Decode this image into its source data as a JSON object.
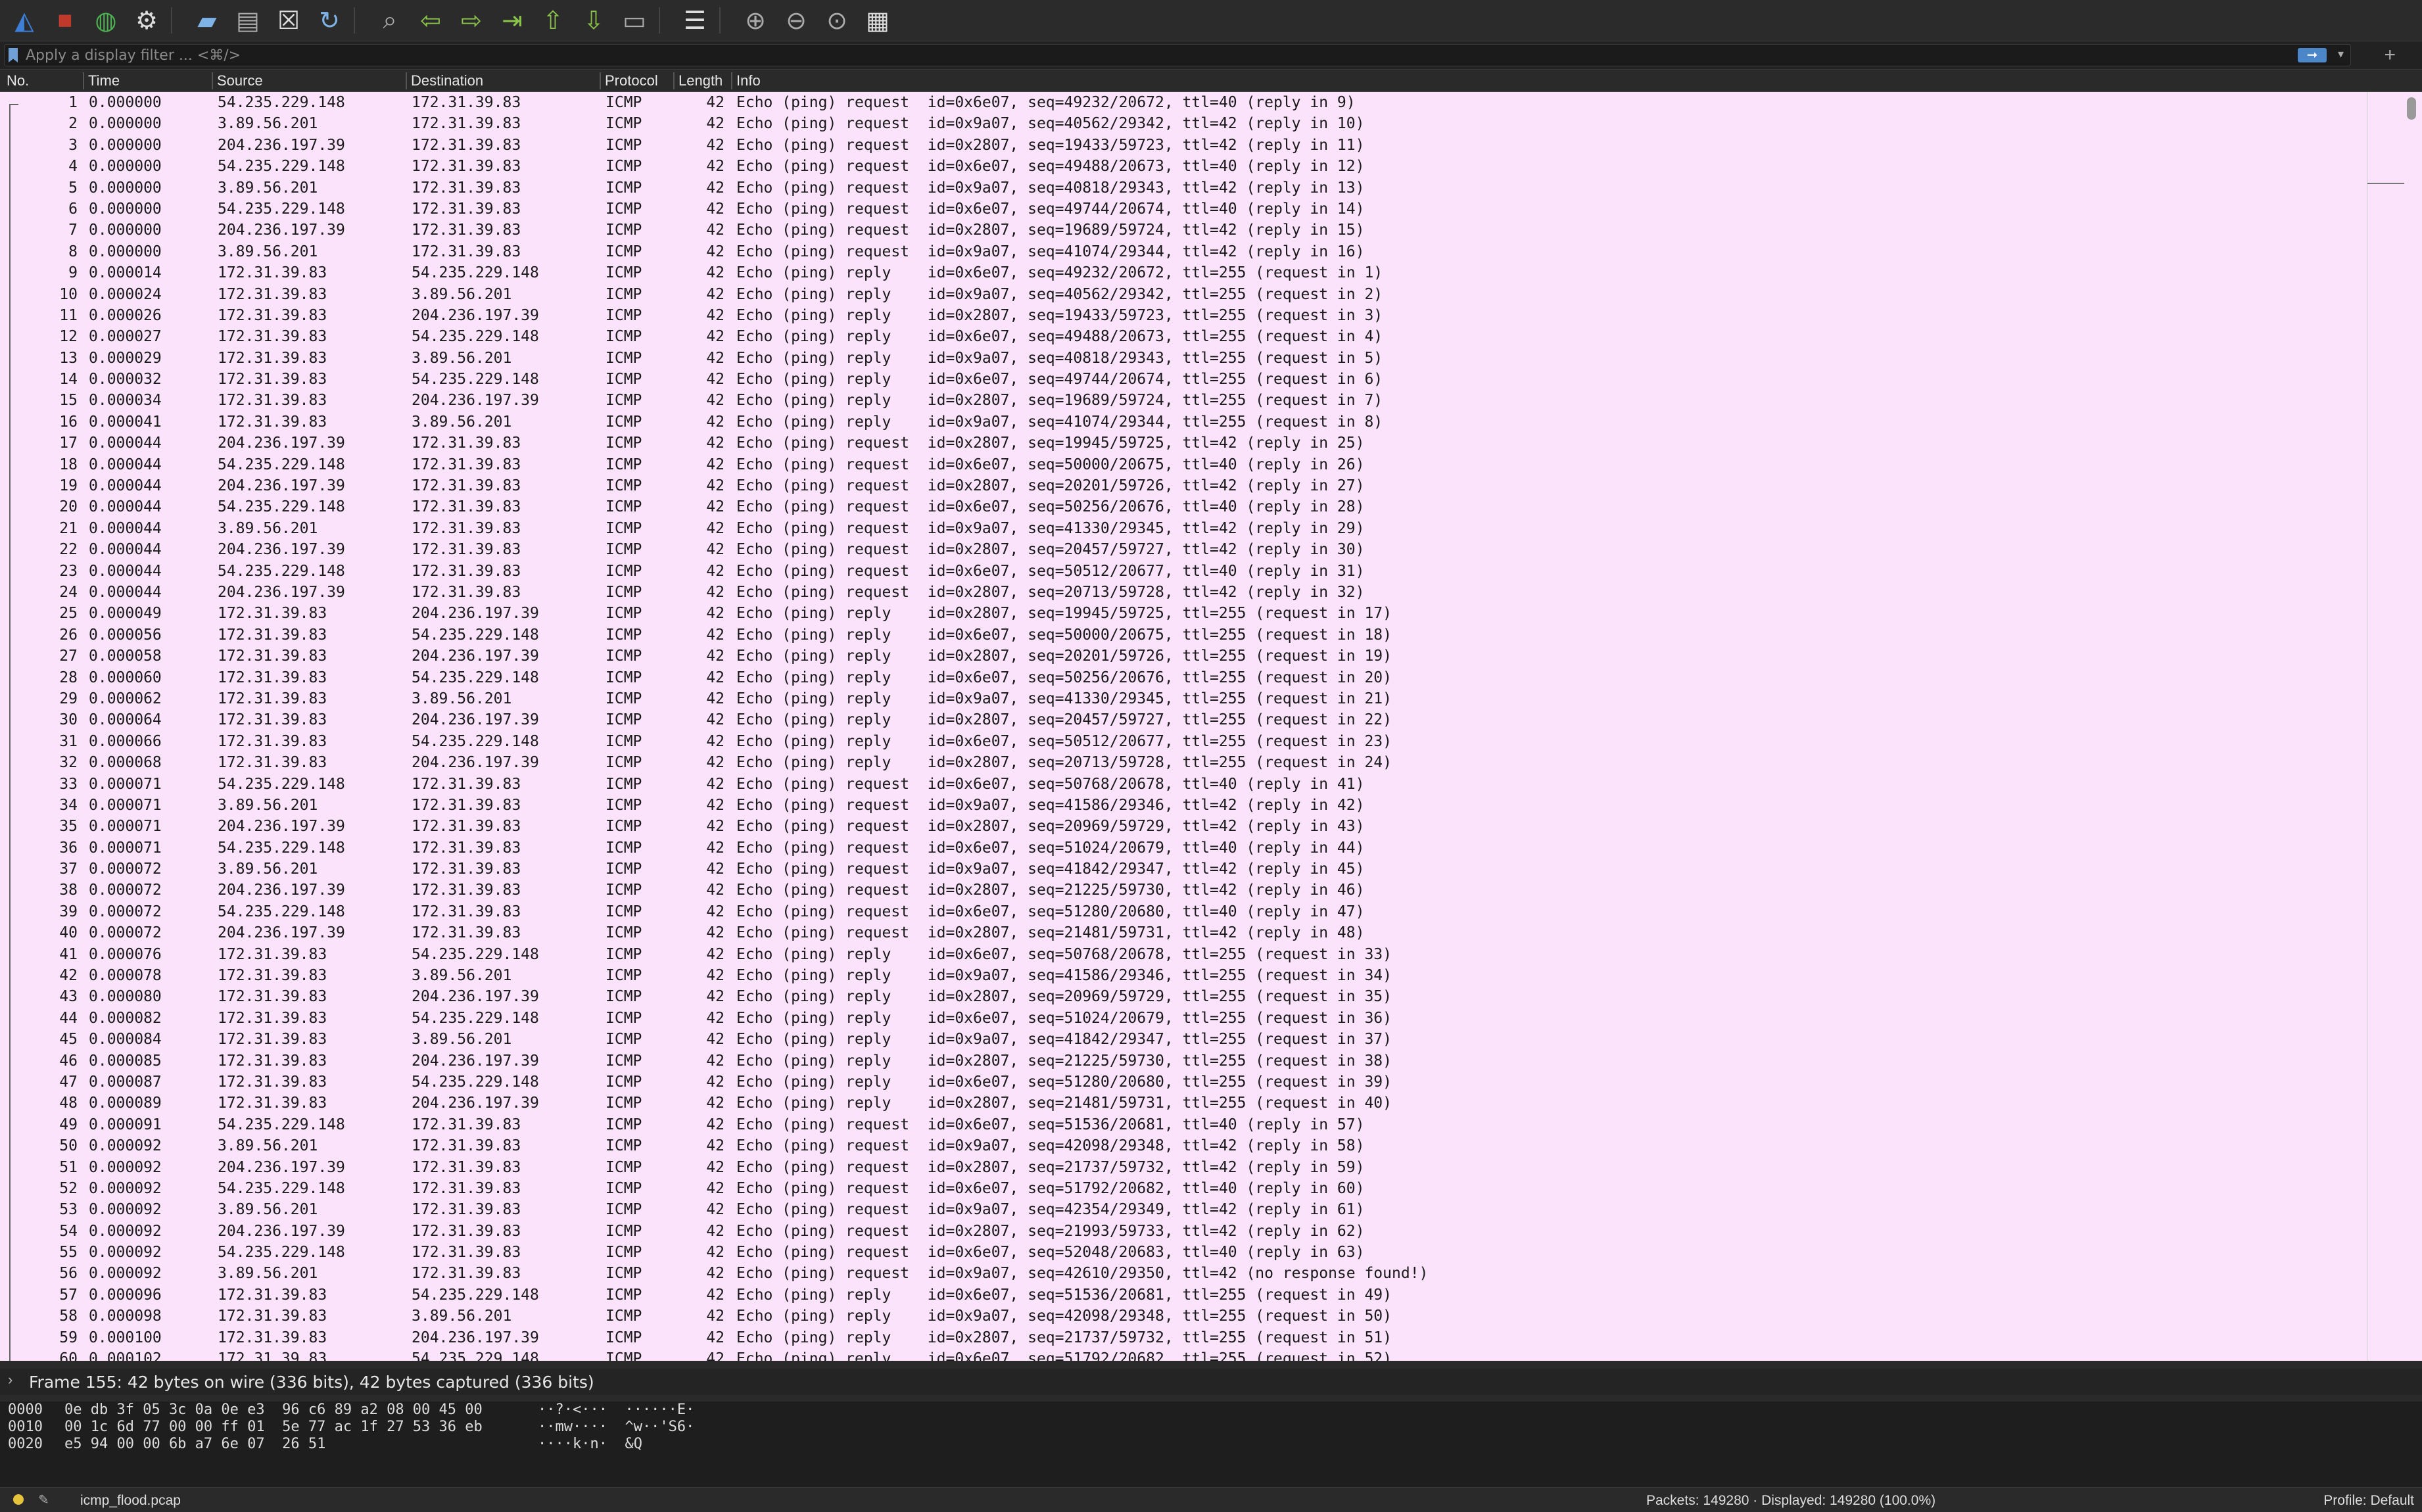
{
  "toolbar": {
    "icons": [
      "shark-fin-icon",
      "stop-icon",
      "restart-icon",
      "gear-icon",
      "open-folder-icon",
      "file-icon",
      "close-file-icon",
      "reload-icon",
      "search-icon",
      "back-arrow-icon",
      "forward-arrow-icon",
      "go-to-packet-icon",
      "first-packet-icon",
      "last-packet-icon",
      "autoscroll-icon",
      "colorize-icon",
      "zoom-in-icon",
      "zoom-out-icon",
      "zoom-normal-icon",
      "resize-columns-icon"
    ]
  },
  "filter": {
    "placeholder": "Apply a display filter ... <⌘/>"
  },
  "columns": {
    "no": "No.",
    "time": "Time",
    "source": "Source",
    "destination": "Destination",
    "protocol": "Protocol",
    "length": "Length",
    "info": "Info"
  },
  "packets": [
    {
      "no": "1",
      "time": "0.000000",
      "src": "54.235.229.148",
      "dst": "172.31.39.83",
      "proto": "ICMP",
      "len": "42",
      "info": "Echo (ping) request  id=0x6e07, seq=49232/20672, ttl=40 (reply in 9)"
    },
    {
      "no": "2",
      "time": "0.000000",
      "src": "3.89.56.201",
      "dst": "172.31.39.83",
      "proto": "ICMP",
      "len": "42",
      "info": "Echo (ping) request  id=0x9a07, seq=40562/29342, ttl=42 (reply in 10)"
    },
    {
      "no": "3",
      "time": "0.000000",
      "src": "204.236.197.39",
      "dst": "172.31.39.83",
      "proto": "ICMP",
      "len": "42",
      "info": "Echo (ping) request  id=0x2807, seq=19433/59723, ttl=42 (reply in 11)"
    },
    {
      "no": "4",
      "time": "0.000000",
      "src": "54.235.229.148",
      "dst": "172.31.39.83",
      "proto": "ICMP",
      "len": "42",
      "info": "Echo (ping) request  id=0x6e07, seq=49488/20673, ttl=40 (reply in 12)"
    },
    {
      "no": "5",
      "time": "0.000000",
      "src": "3.89.56.201",
      "dst": "172.31.39.83",
      "proto": "ICMP",
      "len": "42",
      "info": "Echo (ping) request  id=0x9a07, seq=40818/29343, ttl=42 (reply in 13)"
    },
    {
      "no": "6",
      "time": "0.000000",
      "src": "54.235.229.148",
      "dst": "172.31.39.83",
      "proto": "ICMP",
      "len": "42",
      "info": "Echo (ping) request  id=0x6e07, seq=49744/20674, ttl=40 (reply in 14)"
    },
    {
      "no": "7",
      "time": "0.000000",
      "src": "204.236.197.39",
      "dst": "172.31.39.83",
      "proto": "ICMP",
      "len": "42",
      "info": "Echo (ping) request  id=0x2807, seq=19689/59724, ttl=42 (reply in 15)"
    },
    {
      "no": "8",
      "time": "0.000000",
      "src": "3.89.56.201",
      "dst": "172.31.39.83",
      "proto": "ICMP",
      "len": "42",
      "info": "Echo (ping) request  id=0x9a07, seq=41074/29344, ttl=42 (reply in 16)"
    },
    {
      "no": "9",
      "time": "0.000014",
      "src": "172.31.39.83",
      "dst": "54.235.229.148",
      "proto": "ICMP",
      "len": "42",
      "info": "Echo (ping) reply    id=0x6e07, seq=49232/20672, ttl=255 (request in 1)"
    },
    {
      "no": "10",
      "time": "0.000024",
      "src": "172.31.39.83",
      "dst": "3.89.56.201",
      "proto": "ICMP",
      "len": "42",
      "info": "Echo (ping) reply    id=0x9a07, seq=40562/29342, ttl=255 (request in 2)"
    },
    {
      "no": "11",
      "time": "0.000026",
      "src": "172.31.39.83",
      "dst": "204.236.197.39",
      "proto": "ICMP",
      "len": "42",
      "info": "Echo (ping) reply    id=0x2807, seq=19433/59723, ttl=255 (request in 3)"
    },
    {
      "no": "12",
      "time": "0.000027",
      "src": "172.31.39.83",
      "dst": "54.235.229.148",
      "proto": "ICMP",
      "len": "42",
      "info": "Echo (ping) reply    id=0x6e07, seq=49488/20673, ttl=255 (request in 4)"
    },
    {
      "no": "13",
      "time": "0.000029",
      "src": "172.31.39.83",
      "dst": "3.89.56.201",
      "proto": "ICMP",
      "len": "42",
      "info": "Echo (ping) reply    id=0x9a07, seq=40818/29343, ttl=255 (request in 5)"
    },
    {
      "no": "14",
      "time": "0.000032",
      "src": "172.31.39.83",
      "dst": "54.235.229.148",
      "proto": "ICMP",
      "len": "42",
      "info": "Echo (ping) reply    id=0x6e07, seq=49744/20674, ttl=255 (request in 6)"
    },
    {
      "no": "15",
      "time": "0.000034",
      "src": "172.31.39.83",
      "dst": "204.236.197.39",
      "proto": "ICMP",
      "len": "42",
      "info": "Echo (ping) reply    id=0x2807, seq=19689/59724, ttl=255 (request in 7)"
    },
    {
      "no": "16",
      "time": "0.000041",
      "src": "172.31.39.83",
      "dst": "3.89.56.201",
      "proto": "ICMP",
      "len": "42",
      "info": "Echo (ping) reply    id=0x9a07, seq=41074/29344, ttl=255 (request in 8)"
    },
    {
      "no": "17",
      "time": "0.000044",
      "src": "204.236.197.39",
      "dst": "172.31.39.83",
      "proto": "ICMP",
      "len": "42",
      "info": "Echo (ping) request  id=0x2807, seq=19945/59725, ttl=42 (reply in 25)"
    },
    {
      "no": "18",
      "time": "0.000044",
      "src": "54.235.229.148",
      "dst": "172.31.39.83",
      "proto": "ICMP",
      "len": "42",
      "info": "Echo (ping) request  id=0x6e07, seq=50000/20675, ttl=40 (reply in 26)"
    },
    {
      "no": "19",
      "time": "0.000044",
      "src": "204.236.197.39",
      "dst": "172.31.39.83",
      "proto": "ICMP",
      "len": "42",
      "info": "Echo (ping) request  id=0x2807, seq=20201/59726, ttl=42 (reply in 27)"
    },
    {
      "no": "20",
      "time": "0.000044",
      "src": "54.235.229.148",
      "dst": "172.31.39.83",
      "proto": "ICMP",
      "len": "42",
      "info": "Echo (ping) request  id=0x6e07, seq=50256/20676, ttl=40 (reply in 28)"
    },
    {
      "no": "21",
      "time": "0.000044",
      "src": "3.89.56.201",
      "dst": "172.31.39.83",
      "proto": "ICMP",
      "len": "42",
      "info": "Echo (ping) request  id=0x9a07, seq=41330/29345, ttl=42 (reply in 29)"
    },
    {
      "no": "22",
      "time": "0.000044",
      "src": "204.236.197.39",
      "dst": "172.31.39.83",
      "proto": "ICMP",
      "len": "42",
      "info": "Echo (ping) request  id=0x2807, seq=20457/59727, ttl=42 (reply in 30)"
    },
    {
      "no": "23",
      "time": "0.000044",
      "src": "54.235.229.148",
      "dst": "172.31.39.83",
      "proto": "ICMP",
      "len": "42",
      "info": "Echo (ping) request  id=0x6e07, seq=50512/20677, ttl=40 (reply in 31)"
    },
    {
      "no": "24",
      "time": "0.000044",
      "src": "204.236.197.39",
      "dst": "172.31.39.83",
      "proto": "ICMP",
      "len": "42",
      "info": "Echo (ping) request  id=0x2807, seq=20713/59728, ttl=42 (reply in 32)"
    },
    {
      "no": "25",
      "time": "0.000049",
      "src": "172.31.39.83",
      "dst": "204.236.197.39",
      "proto": "ICMP",
      "len": "42",
      "info": "Echo (ping) reply    id=0x2807, seq=19945/59725, ttl=255 (request in 17)"
    },
    {
      "no": "26",
      "time": "0.000056",
      "src": "172.31.39.83",
      "dst": "54.235.229.148",
      "proto": "ICMP",
      "len": "42",
      "info": "Echo (ping) reply    id=0x6e07, seq=50000/20675, ttl=255 (request in 18)"
    },
    {
      "no": "27",
      "time": "0.000058",
      "src": "172.31.39.83",
      "dst": "204.236.197.39",
      "proto": "ICMP",
      "len": "42",
      "info": "Echo (ping) reply    id=0x2807, seq=20201/59726, ttl=255 (request in 19)"
    },
    {
      "no": "28",
      "time": "0.000060",
      "src": "172.31.39.83",
      "dst": "54.235.229.148",
      "proto": "ICMP",
      "len": "42",
      "info": "Echo (ping) reply    id=0x6e07, seq=50256/20676, ttl=255 (request in 20)"
    },
    {
      "no": "29",
      "time": "0.000062",
      "src": "172.31.39.83",
      "dst": "3.89.56.201",
      "proto": "ICMP",
      "len": "42",
      "info": "Echo (ping) reply    id=0x9a07, seq=41330/29345, ttl=255 (request in 21)"
    },
    {
      "no": "30",
      "time": "0.000064",
      "src": "172.31.39.83",
      "dst": "204.236.197.39",
      "proto": "ICMP",
      "len": "42",
      "info": "Echo (ping) reply    id=0x2807, seq=20457/59727, ttl=255 (request in 22)"
    },
    {
      "no": "31",
      "time": "0.000066",
      "src": "172.31.39.83",
      "dst": "54.235.229.148",
      "proto": "ICMP",
      "len": "42",
      "info": "Echo (ping) reply    id=0x6e07, seq=50512/20677, ttl=255 (request in 23)"
    },
    {
      "no": "32",
      "time": "0.000068",
      "src": "172.31.39.83",
      "dst": "204.236.197.39",
      "proto": "ICMP",
      "len": "42",
      "info": "Echo (ping) reply    id=0x2807, seq=20713/59728, ttl=255 (request in 24)"
    },
    {
      "no": "33",
      "time": "0.000071",
      "src": "54.235.229.148",
      "dst": "172.31.39.83",
      "proto": "ICMP",
      "len": "42",
      "info": "Echo (ping) request  id=0x6e07, seq=50768/20678, ttl=40 (reply in 41)"
    },
    {
      "no": "34",
      "time": "0.000071",
      "src": "3.89.56.201",
      "dst": "172.31.39.83",
      "proto": "ICMP",
      "len": "42",
      "info": "Echo (ping) request  id=0x9a07, seq=41586/29346, ttl=42 (reply in 42)"
    },
    {
      "no": "35",
      "time": "0.000071",
      "src": "204.236.197.39",
      "dst": "172.31.39.83",
      "proto": "ICMP",
      "len": "42",
      "info": "Echo (ping) request  id=0x2807, seq=20969/59729, ttl=42 (reply in 43)"
    },
    {
      "no": "36",
      "time": "0.000071",
      "src": "54.235.229.148",
      "dst": "172.31.39.83",
      "proto": "ICMP",
      "len": "42",
      "info": "Echo (ping) request  id=0x6e07, seq=51024/20679, ttl=40 (reply in 44)"
    },
    {
      "no": "37",
      "time": "0.000072",
      "src": "3.89.56.201",
      "dst": "172.31.39.83",
      "proto": "ICMP",
      "len": "42",
      "info": "Echo (ping) request  id=0x9a07, seq=41842/29347, ttl=42 (reply in 45)"
    },
    {
      "no": "38",
      "time": "0.000072",
      "src": "204.236.197.39",
      "dst": "172.31.39.83",
      "proto": "ICMP",
      "len": "42",
      "info": "Echo (ping) request  id=0x2807, seq=21225/59730, ttl=42 (reply in 46)"
    },
    {
      "no": "39",
      "time": "0.000072",
      "src": "54.235.229.148",
      "dst": "172.31.39.83",
      "proto": "ICMP",
      "len": "42",
      "info": "Echo (ping) request  id=0x6e07, seq=51280/20680, ttl=40 (reply in 47)"
    },
    {
      "no": "40",
      "time": "0.000072",
      "src": "204.236.197.39",
      "dst": "172.31.39.83",
      "proto": "ICMP",
      "len": "42",
      "info": "Echo (ping) request  id=0x2807, seq=21481/59731, ttl=42 (reply in 48)"
    },
    {
      "no": "41",
      "time": "0.000076",
      "src": "172.31.39.83",
      "dst": "54.235.229.148",
      "proto": "ICMP",
      "len": "42",
      "info": "Echo (ping) reply    id=0x6e07, seq=50768/20678, ttl=255 (request in 33)"
    },
    {
      "no": "42",
      "time": "0.000078",
      "src": "172.31.39.83",
      "dst": "3.89.56.201",
      "proto": "ICMP",
      "len": "42",
      "info": "Echo (ping) reply    id=0x9a07, seq=41586/29346, ttl=255 (request in 34)"
    },
    {
      "no": "43",
      "time": "0.000080",
      "src": "172.31.39.83",
      "dst": "204.236.197.39",
      "proto": "ICMP",
      "len": "42",
      "info": "Echo (ping) reply    id=0x2807, seq=20969/59729, ttl=255 (request in 35)"
    },
    {
      "no": "44",
      "time": "0.000082",
      "src": "172.31.39.83",
      "dst": "54.235.229.148",
      "proto": "ICMP",
      "len": "42",
      "info": "Echo (ping) reply    id=0x6e07, seq=51024/20679, ttl=255 (request in 36)"
    },
    {
      "no": "45",
      "time": "0.000084",
      "src": "172.31.39.83",
      "dst": "3.89.56.201",
      "proto": "ICMP",
      "len": "42",
      "info": "Echo (ping) reply    id=0x9a07, seq=41842/29347, ttl=255 (request in 37)"
    },
    {
      "no": "46",
      "time": "0.000085",
      "src": "172.31.39.83",
      "dst": "204.236.197.39",
      "proto": "ICMP",
      "len": "42",
      "info": "Echo (ping) reply    id=0x2807, seq=21225/59730, ttl=255 (request in 38)"
    },
    {
      "no": "47",
      "time": "0.000087",
      "src": "172.31.39.83",
      "dst": "54.235.229.148",
      "proto": "ICMP",
      "len": "42",
      "info": "Echo (ping) reply    id=0x6e07, seq=51280/20680, ttl=255 (request in 39)"
    },
    {
      "no": "48",
      "time": "0.000089",
      "src": "172.31.39.83",
      "dst": "204.236.197.39",
      "proto": "ICMP",
      "len": "42",
      "info": "Echo (ping) reply    id=0x2807, seq=21481/59731, ttl=255 (request in 40)"
    },
    {
      "no": "49",
      "time": "0.000091",
      "src": "54.235.229.148",
      "dst": "172.31.39.83",
      "proto": "ICMP",
      "len": "42",
      "info": "Echo (ping) request  id=0x6e07, seq=51536/20681, ttl=40 (reply in 57)"
    },
    {
      "no": "50",
      "time": "0.000092",
      "src": "3.89.56.201",
      "dst": "172.31.39.83",
      "proto": "ICMP",
      "len": "42",
      "info": "Echo (ping) request  id=0x9a07, seq=42098/29348, ttl=42 (reply in 58)"
    },
    {
      "no": "51",
      "time": "0.000092",
      "src": "204.236.197.39",
      "dst": "172.31.39.83",
      "proto": "ICMP",
      "len": "42",
      "info": "Echo (ping) request  id=0x2807, seq=21737/59732, ttl=42 (reply in 59)"
    },
    {
      "no": "52",
      "time": "0.000092",
      "src": "54.235.229.148",
      "dst": "172.31.39.83",
      "proto": "ICMP",
      "len": "42",
      "info": "Echo (ping) request  id=0x6e07, seq=51792/20682, ttl=40 (reply in 60)"
    },
    {
      "no": "53",
      "time": "0.000092",
      "src": "3.89.56.201",
      "dst": "172.31.39.83",
      "proto": "ICMP",
      "len": "42",
      "info": "Echo (ping) request  id=0x9a07, seq=42354/29349, ttl=42 (reply in 61)"
    },
    {
      "no": "54",
      "time": "0.000092",
      "src": "204.236.197.39",
      "dst": "172.31.39.83",
      "proto": "ICMP",
      "len": "42",
      "info": "Echo (ping) request  id=0x2807, seq=21993/59733, ttl=42 (reply in 62)"
    },
    {
      "no": "55",
      "time": "0.000092",
      "src": "54.235.229.148",
      "dst": "172.31.39.83",
      "proto": "ICMP",
      "len": "42",
      "info": "Echo (ping) request  id=0x6e07, seq=52048/20683, ttl=40 (reply in 63)"
    },
    {
      "no": "56",
      "time": "0.000092",
      "src": "3.89.56.201",
      "dst": "172.31.39.83",
      "proto": "ICMP",
      "len": "42",
      "info": "Echo (ping) request  id=0x9a07, seq=42610/29350, ttl=42 (no response found!)"
    },
    {
      "no": "57",
      "time": "0.000096",
      "src": "172.31.39.83",
      "dst": "54.235.229.148",
      "proto": "ICMP",
      "len": "42",
      "info": "Echo (ping) reply    id=0x6e07, seq=51536/20681, ttl=255 (request in 49)"
    },
    {
      "no": "58",
      "time": "0.000098",
      "src": "172.31.39.83",
      "dst": "3.89.56.201",
      "proto": "ICMP",
      "len": "42",
      "info": "Echo (ping) reply    id=0x9a07, seq=42098/29348, ttl=255 (request in 50)"
    },
    {
      "no": "59",
      "time": "0.000100",
      "src": "172.31.39.83",
      "dst": "204.236.197.39",
      "proto": "ICMP",
      "len": "42",
      "info": "Echo (ping) reply    id=0x2807, seq=21737/59732, ttl=255 (request in 51)"
    },
    {
      "no": "60",
      "time": "0.000102",
      "src": "172.31.39.83",
      "dst": "54.235.229.148",
      "proto": "ICMP",
      "len": "42",
      "info": "Echo (ping) reply    id=0x6e07, seq=51792/20682, ttl=255 (request in 52)"
    }
  ],
  "detail": {
    "summary": "Frame 155: 42 bytes on wire (336 bits), 42 bytes captured (336 bits)"
  },
  "bytes": [
    {
      "offset": "0000",
      "hex": "0e db 3f 05 3c 0a 0e e3  96 c6 89 a2 08 00 45 00",
      "ascii": "··?·<···  ······E·"
    },
    {
      "offset": "0010",
      "hex": "00 1c 6d 77 00 00 ff 01  5e 77 ac 1f 27 53 36 eb",
      "ascii": "··mw····  ^w··'S6·"
    },
    {
      "offset": "0020",
      "hex": "e5 94 00 00 6b a7 6e 07  26 51",
      "ascii": "····k·n·  &Q"
    }
  ],
  "status": {
    "file": "icmp_flood.pcap",
    "packets": "Packets: 149280 · Displayed: 149280 (100.0%)",
    "profile": "Profile: Default"
  },
  "colors": {
    "row_bg": "#fbe3fb",
    "accent": "#4a86c8"
  }
}
